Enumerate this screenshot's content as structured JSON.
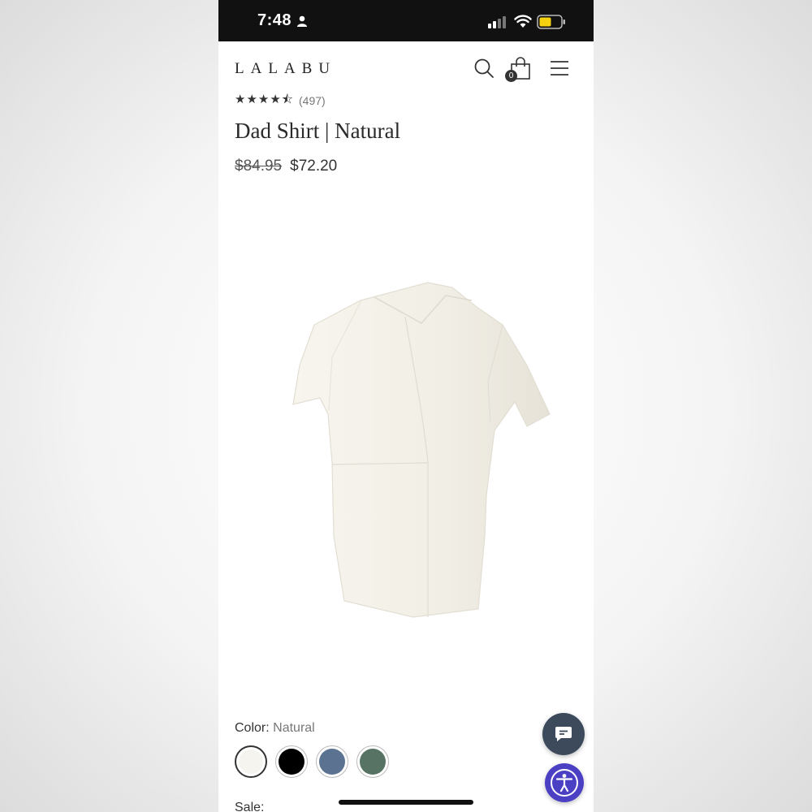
{
  "status_bar": {
    "time": "7:48",
    "icons": [
      "person-icon",
      "signal-icon",
      "wifi-icon",
      "battery-icon"
    ],
    "battery_color": "#f5d210"
  },
  "header": {
    "logo": "LALABU",
    "cart_count": "0",
    "icons": [
      "search-icon",
      "bag-icon",
      "menu-icon"
    ]
  },
  "product": {
    "stars": "★★★★⯪",
    "rating_icon": "star-icon",
    "review_count": "(497)",
    "title": "Dad Shirt | Natural",
    "price_original": "$84.95",
    "price_sale": "$72.20"
  },
  "color": {
    "label": "Color:",
    "selected": "Natural",
    "swatches": [
      {
        "name": "natural",
        "hex": "#f6f4ee"
      },
      {
        "name": "black",
        "hex": "#000000"
      },
      {
        "name": "blue",
        "hex": "#5b7390"
      },
      {
        "name": "green",
        "hex": "#567363"
      }
    ]
  },
  "sale": {
    "label": "Sale:"
  },
  "floating": {
    "chat_color": "#3d4a5c",
    "accessibility_color": "#4b3fc4"
  }
}
